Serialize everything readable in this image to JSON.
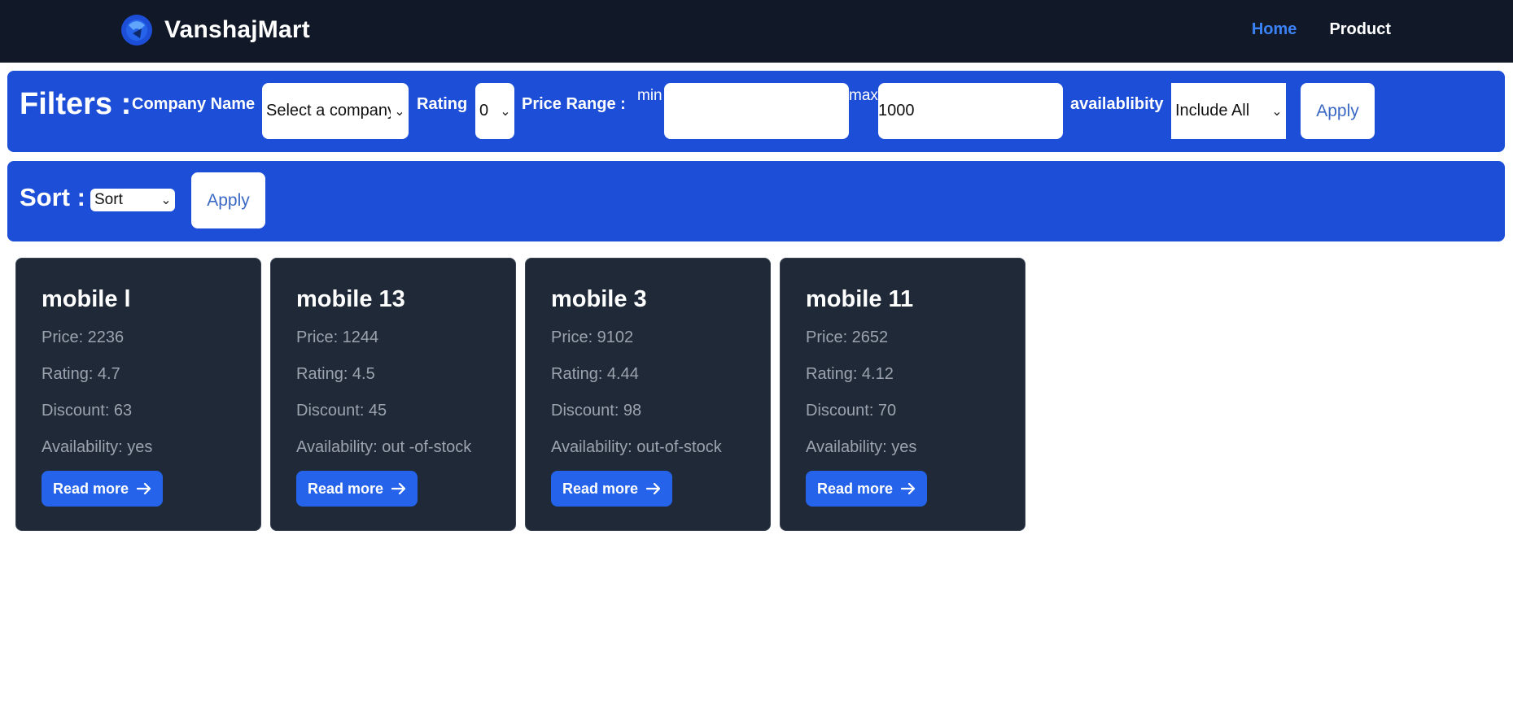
{
  "navbar": {
    "brand": "VanshajMart",
    "links": [
      {
        "label": "Home",
        "active": true
      },
      {
        "label": "Product",
        "active": false
      }
    ]
  },
  "filters": {
    "title": "Filters :",
    "company_label": "Company Name",
    "company_value": "Select a company",
    "rating_label": "Rating",
    "rating_value": "0",
    "price_label": "Price Range :",
    "min_label": "min",
    "min_value": "",
    "max_label": "max",
    "max_value": "1000",
    "availability_label": "availablibity",
    "availability_value": "Include All",
    "apply_label": "Apply"
  },
  "sort": {
    "title": "Sort :",
    "select_value": "Sort",
    "apply_label": "Apply"
  },
  "products": [
    {
      "name": "mobile l",
      "price": "Price: 2236",
      "rating": "Rating: 4.7",
      "discount": "Discount: 63",
      "availability": "Availability: yes",
      "button": "Read more"
    },
    {
      "name": "mobile 13",
      "price": "Price: 1244",
      "rating": "Rating: 4.5",
      "discount": "Discount: 45",
      "availability": "Availability: out -of-stock",
      "button": "Read more"
    },
    {
      "name": "mobile 3",
      "price": "Price: 9102",
      "rating": "Rating: 4.44",
      "discount": "Discount: 98",
      "availability": "Availability: out-of-stock",
      "button": "Read more"
    },
    {
      "name": "mobile 11",
      "price": "Price: 2652",
      "rating": "Rating: 4.12",
      "discount": "Discount: 70",
      "availability": "Availability: yes",
      "button": "Read more"
    }
  ],
  "colors": {
    "navbar_bg": "#111827",
    "accent": "#3b82f6",
    "panel_bg": "#1d4ed8",
    "card_bg": "#1f2937",
    "button_bg": "#2563eb"
  },
  "icons": {
    "logo": "brand-logo-icon",
    "arrow": "arrow-right-icon",
    "chevron": "chevron-down-icon"
  }
}
